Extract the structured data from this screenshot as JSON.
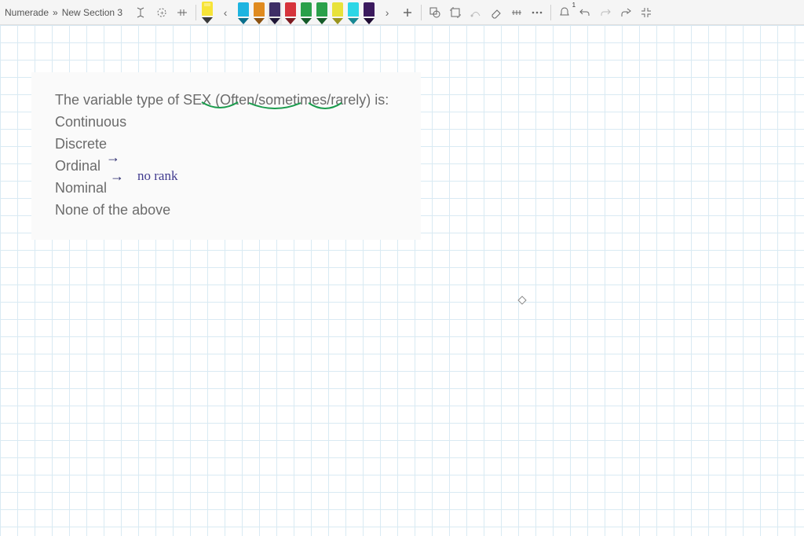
{
  "breadcrumb": {
    "root": "Numerade",
    "sep": "»",
    "current": "New Section 3"
  },
  "toolbar": {
    "arrow_prev": "‹",
    "arrow_next": "›"
  },
  "pens": {
    "yellow_hl": "#f7e437",
    "blue": "#1db4e0",
    "orange": "#e08b1f",
    "purple": "#3e2e66",
    "red": "#d6343c",
    "green1": "#2aa04a",
    "green2": "#2aa04a",
    "yellow2": "#e8e23a",
    "cyan": "#2cd6e6",
    "dk_purple": "#3b1a5e"
  },
  "question": {
    "prompt_pre": "The variable type of SEX (",
    "opt_often": "Often",
    "slash1": "/",
    "opt_sometimes": "sometimes",
    "slash2": "/",
    "opt_rarely": "rarely",
    "prompt_post": ") is:",
    "choices": {
      "a": "Continuous",
      "b": "Discrete",
      "c": "Ordinal",
      "d": "Nominal",
      "e": "None of the above"
    }
  },
  "annotations": {
    "arrow1": "→",
    "arrow2": "→",
    "no_rank": "no rank"
  }
}
